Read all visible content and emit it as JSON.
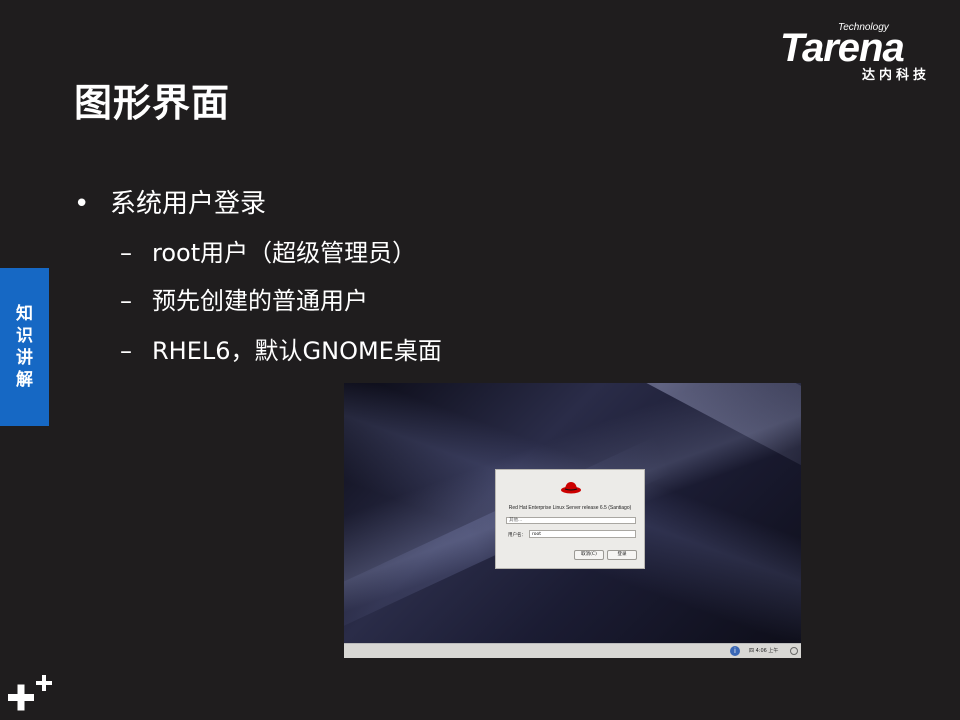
{
  "logo": {
    "technology": "Technology",
    "brand": "Tarena",
    "chinese": "达内科技"
  },
  "page_title": "图形界面",
  "side_tab": [
    "知",
    "识",
    "讲",
    "解"
  ],
  "bullets": {
    "main": "系统用户登录",
    "subs": [
      "root用户（超级管理员）",
      "预先创建的普通用户",
      "RHEL6，默认GNOME桌面"
    ]
  },
  "screenshot": {
    "dialog_title": "Red Hat Enterprise Linux Server release 6.5 (Santiago)",
    "other_placeholder": "其他...",
    "user_label": "用户名：",
    "user_value": "root",
    "cancel_label": "取消(C)",
    "login_label": "登录",
    "taskbar_text": "四 4:06 上午"
  },
  "colors": {
    "background": "#1f1d1e",
    "side_tab": "#1668c4",
    "text": "#ffffff"
  }
}
